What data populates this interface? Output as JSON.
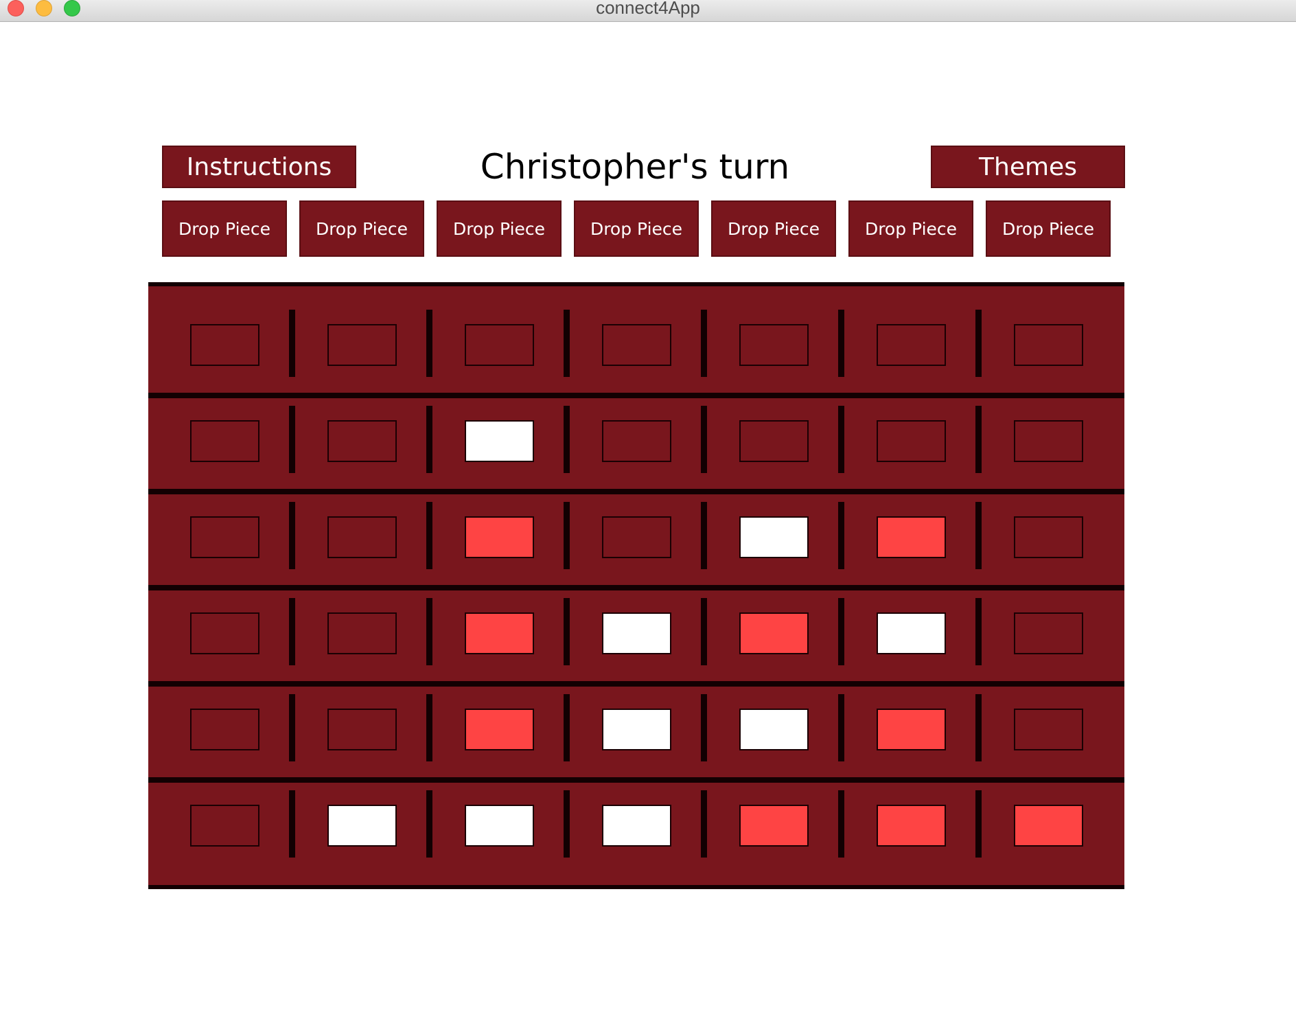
{
  "window": {
    "title": "connect4App"
  },
  "header": {
    "instructions_label": "Instructions",
    "turn_text": "Christopher's turn",
    "themes_label": "Themes"
  },
  "drop_buttons": [
    "Drop Piece",
    "Drop Piece",
    "Drop Piece",
    "Drop Piece",
    "Drop Piece",
    "Drop Piece",
    "Drop Piece"
  ],
  "board": {
    "rows": 6,
    "columns": 7,
    "cells": [
      [
        "empty",
        "empty",
        "empty",
        "empty",
        "empty",
        "empty",
        "empty"
      ],
      [
        "empty",
        "empty",
        "white",
        "empty",
        "empty",
        "empty",
        "empty"
      ],
      [
        "empty",
        "empty",
        "red",
        "empty",
        "white",
        "red",
        "empty"
      ],
      [
        "empty",
        "empty",
        "red",
        "white",
        "red",
        "white",
        "empty"
      ],
      [
        "empty",
        "empty",
        "red",
        "white",
        "white",
        "red",
        "empty"
      ],
      [
        "empty",
        "white",
        "white",
        "white",
        "red",
        "red",
        "red"
      ]
    ]
  },
  "colors": {
    "board": "#79161d",
    "grid_lines": "#120002",
    "red_piece": "#fe4444",
    "white_piece": "#ffffff",
    "button_bg": "#79161d",
    "button_text": "#ffffff"
  }
}
